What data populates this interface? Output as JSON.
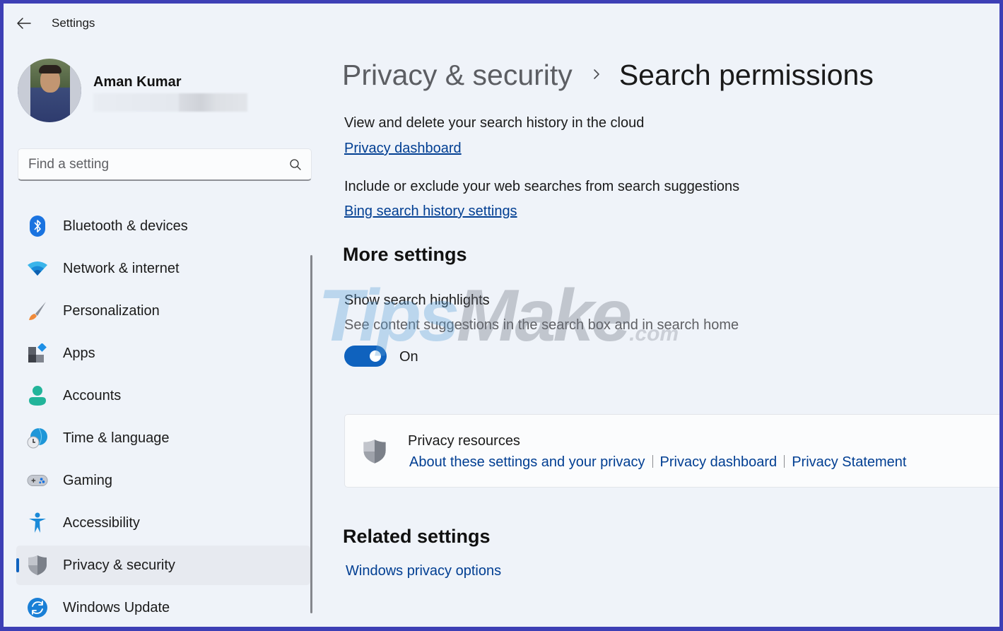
{
  "window": {
    "title": "Settings",
    "border_color": "#3d3fb5",
    "background_color": "#eff3f9"
  },
  "titlebar": {
    "back_icon": "arrow-left-icon",
    "title": "Settings"
  },
  "profile": {
    "name": "Aman Kumar",
    "email": "",
    "email_redacted": true,
    "avatar": "user-photo"
  },
  "search": {
    "placeholder": "Find a setting",
    "value": "",
    "icon": "search-icon"
  },
  "sidebar": {
    "items": [
      {
        "label": "Bluetooth & devices",
        "icon": "bluetooth-icon",
        "selected": false
      },
      {
        "label": "Network & internet",
        "icon": "wifi-icon",
        "selected": false
      },
      {
        "label": "Personalization",
        "icon": "paintbrush-icon",
        "selected": false
      },
      {
        "label": "Apps",
        "icon": "apps-icon",
        "selected": false
      },
      {
        "label": "Accounts",
        "icon": "person-icon",
        "selected": false
      },
      {
        "label": "Time & language",
        "icon": "globe-clock-icon",
        "selected": false
      },
      {
        "label": "Gaming",
        "icon": "gamepad-icon",
        "selected": false
      },
      {
        "label": "Accessibility",
        "icon": "accessibility-icon",
        "selected": false
      },
      {
        "label": "Privacy & security",
        "icon": "shield-icon",
        "selected": true
      },
      {
        "label": "Windows Update",
        "icon": "sync-icon",
        "selected": false
      }
    ]
  },
  "breadcrumb": {
    "parent": "Privacy & security",
    "separator_icon": "chevron-right-icon",
    "current": "Search permissions"
  },
  "main": {
    "history_cloud": {
      "description": "View and delete your search history in the cloud",
      "link": "Privacy dashboard"
    },
    "web_searches": {
      "description": "Include or exclude your web searches from search suggestions",
      "link": "Bing search history settings"
    },
    "more_settings": {
      "title": "More settings",
      "highlights": {
        "label": "Show search highlights",
        "description": "See content suggestions in the search box and in search home",
        "toggle_on": true,
        "state_label": "On"
      }
    },
    "privacy_resources": {
      "icon": "shield-icon",
      "title": "Privacy resources",
      "links": [
        "About these settings and your privacy",
        "Privacy dashboard",
        "Privacy Statement"
      ]
    },
    "related_settings": {
      "title": "Related settings",
      "links": [
        "Windows privacy options"
      ]
    }
  },
  "watermark": {
    "part1": "Tips",
    "part2": "Make",
    "part3": ".com"
  },
  "colors": {
    "accent": "#0f62be",
    "link": "#003e92",
    "text": "#1b1b1b",
    "muted_text": "#5f6064",
    "selected_nav_bg": "#e7eaf0",
    "card_bg": "#fbfcfd"
  }
}
